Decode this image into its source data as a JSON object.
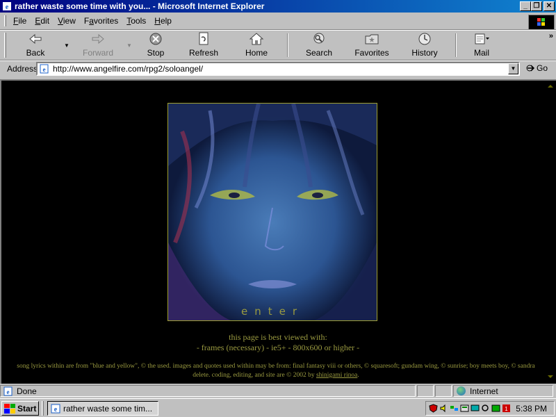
{
  "window": {
    "title": "rather waste some time with you... - Microsoft Internet Explorer",
    "minimize": "_",
    "restore": "❐",
    "close": "✕"
  },
  "menu": {
    "items": [
      "File",
      "Edit",
      "View",
      "Favorites",
      "Tools",
      "Help"
    ],
    "underlines": [
      "F",
      "E",
      "V",
      "a",
      "T",
      "H"
    ]
  },
  "toolbar": {
    "back": "Back",
    "forward": "Forward",
    "stop": "Stop",
    "refresh": "Refresh",
    "home": "Home",
    "search": "Search",
    "favorites": "Favorites",
    "history": "History",
    "mail": "Mail",
    "more": "»"
  },
  "address": {
    "label": "Address",
    "url": "http://www.angelfire.com/rpg2/soloangel/",
    "go": "Go"
  },
  "page": {
    "enter": "enter",
    "best_viewed": "this page is best viewed with:",
    "requirements": "- frames (necessary) - ie5+ - 800x600 or higher -",
    "credits_text": "song lyrics within are from \"blue and yellow\", © the used. images and quotes used within may be from: final fantasy viii or others, © squaresoft; gundam wing, © sunrise; boy meets boy, © sandra delete. coding, editing, and site are © 2002 by ",
    "credits_link": "shinigami rinoa",
    "credits_end": "."
  },
  "status": {
    "text": "Done",
    "zone": "Internet"
  },
  "taskbar": {
    "start": "Start",
    "task": "rather waste some tim...",
    "clock": "5:38 PM"
  },
  "colors": {
    "title_bar": "#000080",
    "page_bg": "#000000",
    "page_text": "#9a9a40",
    "chrome": "#c0c0c0"
  }
}
